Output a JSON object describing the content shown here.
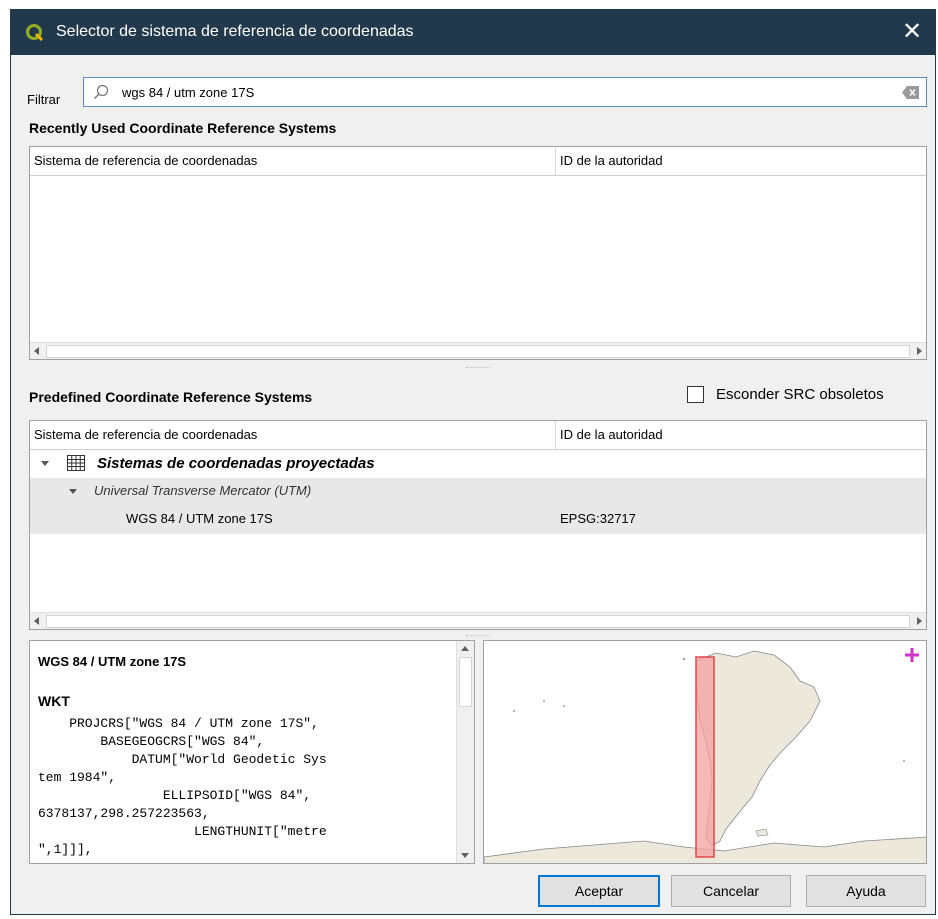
{
  "window": {
    "title": "Selector de sistema de referencia de coordenadas"
  },
  "filter": {
    "label": "Filtrar",
    "value": "wgs 84 / utm zone 17S"
  },
  "recent": {
    "title": "Recently Used Coordinate Reference Systems",
    "columns": [
      "Sistema de referencia de coordenadas",
      "ID de la autoridad"
    ]
  },
  "predefined": {
    "title": "Predefined Coordinate Reference Systems",
    "hide_deprecated_label": "Esconder SRC obsoletos",
    "hide_deprecated_checked": false,
    "columns": [
      "Sistema de referencia de coordenadas",
      "ID de la autoridad"
    ],
    "tree": {
      "group": "Sistemas de coordenadas proyectadas",
      "subgroup": "Universal Transverse Mercator (UTM)",
      "item": {
        "name": "WGS 84 / UTM zone 17S",
        "authority": "EPSG:32717"
      }
    }
  },
  "details": {
    "crs_name": "WGS 84 / UTM zone 17S",
    "wkt_heading": "WKT",
    "wkt_lines": [
      "    PROJCRS[\"WGS 84 / UTM zone 17S\",",
      "        BASEGEOGCRS[\"WGS 84\",",
      "            DATUM[\"World Geodetic Sys",
      "tem 1984\",",
      "                ELLIPSOID[\"WGS 84\",",
      "6378137,298.257223563,",
      "                    LENGTHUNIT[\"metre",
      "\",1]]],"
    ]
  },
  "buttons": {
    "accept": "Aceptar",
    "cancel": "Cancelar",
    "help": "Ayuda"
  },
  "colors": {
    "titlebar": "#22394b",
    "extent_fill": "#f4a0a0",
    "extent_stroke": "#e04848",
    "land": "#ece8dc",
    "add_icon": "#cc33cc"
  }
}
